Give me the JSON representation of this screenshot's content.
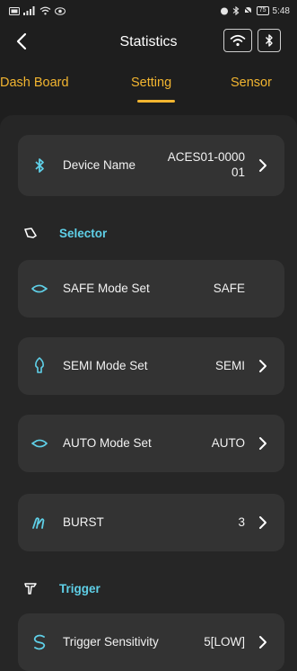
{
  "status_bar": {
    "left_icons": [
      "sim-icon",
      "signal-icon",
      "wifi-icon",
      "eye-icon"
    ],
    "right_icons": [
      "alarm-icon",
      "bluetooth-icon",
      "mute-icon"
    ],
    "battery": "75",
    "time": "5:48"
  },
  "header": {
    "title": "Statistics",
    "back_icon": "chevron-left-icon",
    "wifi_icon": "wifi-icon",
    "bluetooth_icon": "bluetooth-icon"
  },
  "tabs": [
    {
      "label": "Dash Board"
    },
    {
      "label": "Setting",
      "active": true
    },
    {
      "label": "Sensor"
    }
  ],
  "colors": {
    "accent": "#f2b530",
    "section": "#5fd0e8",
    "card": "#333333",
    "background": "#1e1e1e"
  },
  "device": {
    "label": "Device Name",
    "value_line1": "ACES01-0000",
    "value_line2": "01",
    "icon": "bluetooth-icon"
  },
  "selector": {
    "title": "Selector",
    "icon": "selector-icon",
    "items": [
      {
        "label": "SAFE Mode Set",
        "value": "SAFE",
        "icon": "safe-mode-icon",
        "chevron": false
      },
      {
        "label": "SEMI Mode Set",
        "value": "SEMI",
        "icon": "semi-mode-icon",
        "chevron": true
      },
      {
        "label": "AUTO Mode Set",
        "value": "AUTO",
        "icon": "auto-mode-icon",
        "chevron": true
      },
      {
        "label": "BURST",
        "value": "3",
        "icon": "burst-icon",
        "chevron": true
      }
    ]
  },
  "trigger": {
    "title": "Trigger",
    "icon": "trigger-icon",
    "items": [
      {
        "label": "Trigger Sensitivity",
        "value": "5[LOW]",
        "icon": "sensitivity-icon",
        "chevron": true
      }
    ]
  }
}
